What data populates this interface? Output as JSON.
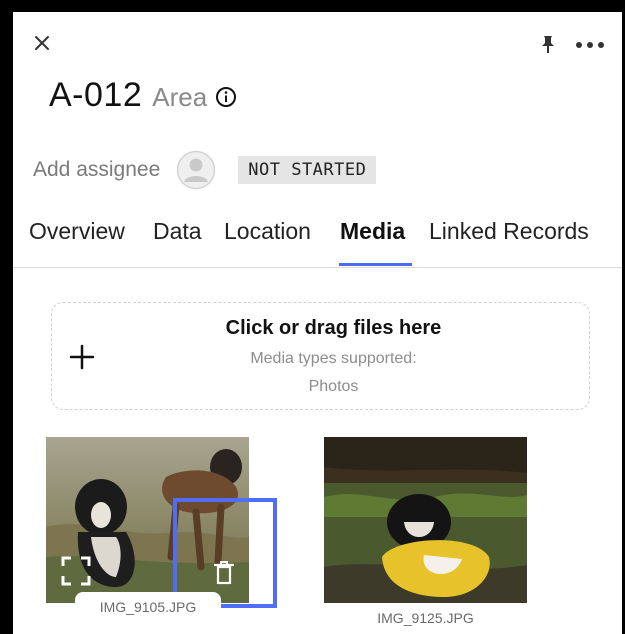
{
  "header": {
    "record_id": "A-012",
    "record_type": "Area"
  },
  "assignee": {
    "label": "Add assignee",
    "status": "NOT STARTED"
  },
  "tabs": [
    {
      "label": "Overview",
      "active": false
    },
    {
      "label": "Data",
      "active": false
    },
    {
      "label": "Location",
      "active": false
    },
    {
      "label": "Media",
      "active": true
    },
    {
      "label": "Linked Records",
      "active": false
    }
  ],
  "dropzone": {
    "title": "Click or drag files here",
    "subtitle": "Media types supported:",
    "types": "Photos"
  },
  "media": [
    {
      "filename": "IMG_9105.JPG"
    },
    {
      "filename": "IMG_9125.JPG"
    }
  ],
  "icons": {
    "close": "close-icon",
    "pin": "pin-icon",
    "more": "more-icon",
    "info": "info-icon",
    "avatar": "avatar-icon",
    "add": "plus-icon",
    "expand": "expand-icon",
    "delete": "trash-icon"
  },
  "colors": {
    "accent": "#4a6cf0",
    "highlight": "#4f6df5",
    "badge_bg": "#e5e5e5"
  }
}
